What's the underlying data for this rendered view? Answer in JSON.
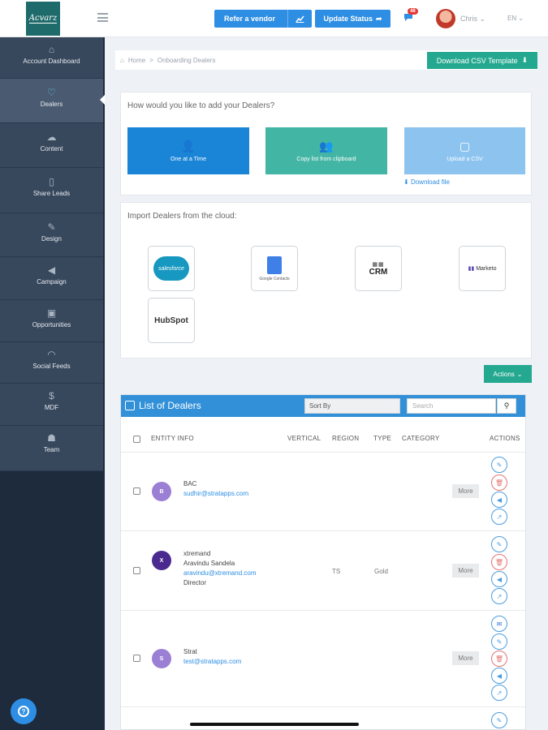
{
  "app": {
    "logo_text": "Acvarz"
  },
  "topbar": {
    "refer_label": "Refer a vendor",
    "update_label": "Update Status",
    "notif_count": "48",
    "user_name": "Chris",
    "lang": "EN"
  },
  "sidebar": {
    "items": [
      {
        "label": "Account Dashboard",
        "icon": "home-icon"
      },
      {
        "label": "Dealers",
        "icon": "handshake-icon"
      },
      {
        "label": "Content",
        "icon": "cloud-icon"
      },
      {
        "label": "Share Leads",
        "icon": "document-icon"
      },
      {
        "label": "Design",
        "icon": "brush-icon"
      },
      {
        "label": "Campaign",
        "icon": "megaphone-icon"
      },
      {
        "label": "Opportunities",
        "icon": "money-icon"
      },
      {
        "label": "Social Feeds",
        "icon": "rss-icon"
      },
      {
        "label": "MDF",
        "icon": "dollar-icon"
      },
      {
        "label": "Team",
        "icon": "team-icon"
      }
    ]
  },
  "breadcrumb": {
    "home": "Home",
    "separator": ">",
    "current": "Onboarding Dealers"
  },
  "download_csv": "Download CSV Template",
  "add_panel": {
    "title": "How would you like to add your Dealers?",
    "options": [
      {
        "label": "One at a Time",
        "color": "#1a85d6"
      },
      {
        "label": "Copy list from clipboard",
        "color": "#43b5a4"
      },
      {
        "label": "Upload a CSV",
        "color": "#8cc3ef"
      }
    ],
    "download_file": "Download file"
  },
  "cloud_panel": {
    "title": "Import Dealers from the cloud:",
    "providers": [
      {
        "name": "salesforce"
      },
      {
        "name": "Google Contacts"
      },
      {
        "name": "CRM"
      },
      {
        "name": "Marketo"
      },
      {
        "name": "HubSpot"
      }
    ]
  },
  "actions_label": "Actions",
  "list": {
    "title": "List of Dealers",
    "sort_label": "Sort By",
    "search_placeholder": "Search",
    "columns": [
      "ENTITY INFO",
      "VERTICAL",
      "REGION",
      "TYPE",
      "CATEGORY",
      "ACTIONS"
    ],
    "rows": [
      {
        "initial": "B",
        "avatar_color": "#9b7fd4",
        "name": "BAC",
        "email": "sudhir@stratapps.com",
        "region": "",
        "type": "",
        "more": "More"
      },
      {
        "initial": "X",
        "avatar_color": "#4a2a8e",
        "name": "xtremand",
        "contact": "Aravindu Sandela",
        "email": "aravindu@xtremand.com",
        "title": "Director",
        "region": "TS",
        "type": "Gold",
        "more": "More"
      },
      {
        "initial": "S",
        "avatar_color": "#9b7fd4",
        "name": "Strat",
        "email": "test@stratapps.com",
        "region": "",
        "type": "",
        "more": "More"
      }
    ]
  }
}
